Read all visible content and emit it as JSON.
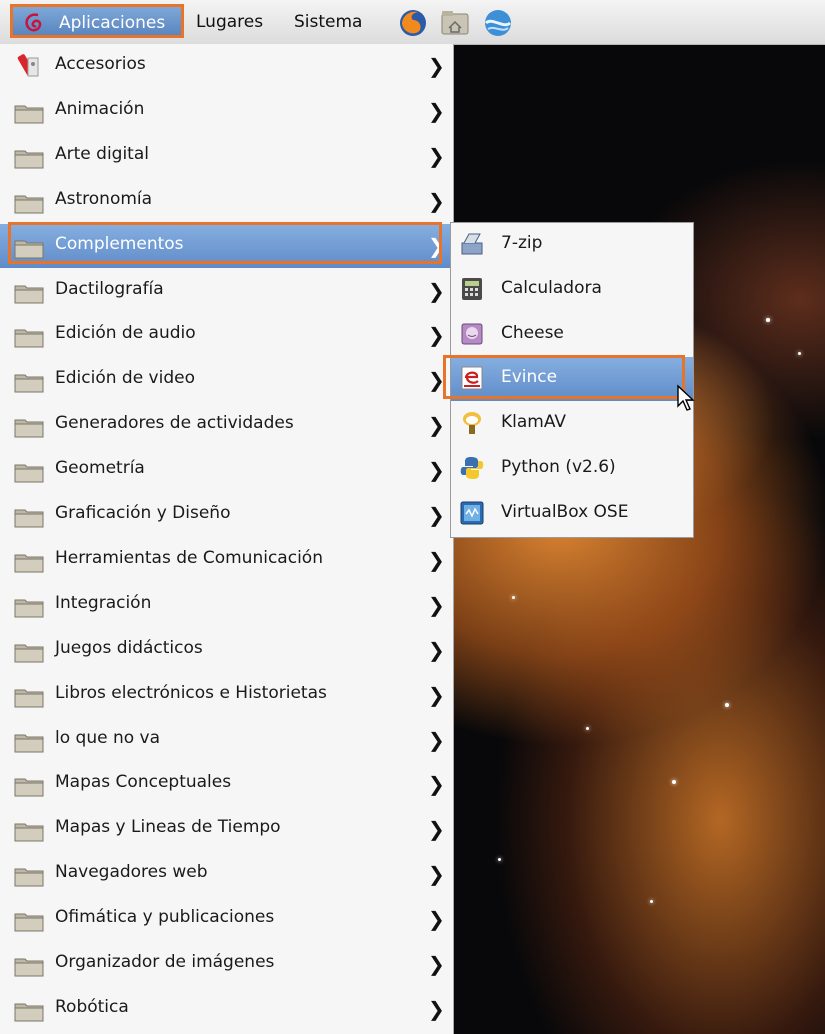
{
  "panel": {
    "applications_label": "Aplicaciones",
    "places_label": "Lugares",
    "system_label": "Sistema",
    "launchers": [
      "firefox-icon",
      "home-folder-icon",
      "network-icon"
    ]
  },
  "menu": {
    "items": [
      {
        "label": "Accesorios",
        "icon": "accessories-icon"
      },
      {
        "label": "Animación",
        "icon": "folder-icon"
      },
      {
        "label": "Arte digital",
        "icon": "folder-icon"
      },
      {
        "label": "Astronomía",
        "icon": "folder-icon"
      },
      {
        "label": "Complementos",
        "icon": "folder-icon",
        "highlighted": true
      },
      {
        "label": "Dactilografía",
        "icon": "folder-icon"
      },
      {
        "label": "Edición de audio",
        "icon": "folder-icon"
      },
      {
        "label": "Edición de video",
        "icon": "folder-icon"
      },
      {
        "label": "Generadores de actividades",
        "icon": "folder-icon"
      },
      {
        "label": "Geometría",
        "icon": "folder-icon"
      },
      {
        "label": "Graficación y Diseño",
        "icon": "folder-icon"
      },
      {
        "label": "Herramientas de Comunicación",
        "icon": "folder-icon"
      },
      {
        "label": "Integración",
        "icon": "folder-icon"
      },
      {
        "label": "Juegos didácticos",
        "icon": "folder-icon"
      },
      {
        "label": "Libros electrónicos e Historietas",
        "icon": "folder-icon"
      },
      {
        "label": "lo que no va",
        "icon": "folder-icon"
      },
      {
        "label": "Mapas Conceptuales",
        "icon": "folder-icon"
      },
      {
        "label": "Mapas y Lineas de Tiempo",
        "icon": "folder-icon"
      },
      {
        "label": "Navegadores web",
        "icon": "folder-icon"
      },
      {
        "label": "Ofimática y publicaciones",
        "icon": "folder-icon"
      },
      {
        "label": "Organizador de imágenes",
        "icon": "folder-icon"
      },
      {
        "label": "Robótica",
        "icon": "folder-icon"
      }
    ]
  },
  "submenu": {
    "items": [
      {
        "label": "7-zip",
        "icon": "archive-icon"
      },
      {
        "label": "Calculadora",
        "icon": "calculator-icon"
      },
      {
        "label": "Cheese",
        "icon": "webcam-icon"
      },
      {
        "label": "Evince",
        "icon": "document-viewer-icon",
        "highlighted": true
      },
      {
        "label": "KlamAV",
        "icon": "antivirus-icon"
      },
      {
        "label": "Python (v2.6)",
        "icon": "python-icon"
      },
      {
        "label": "VirtualBox OSE",
        "icon": "virtualbox-icon"
      }
    ]
  },
  "colors": {
    "highlight_outline": "#e8742a",
    "selection": "#6b95cf"
  }
}
